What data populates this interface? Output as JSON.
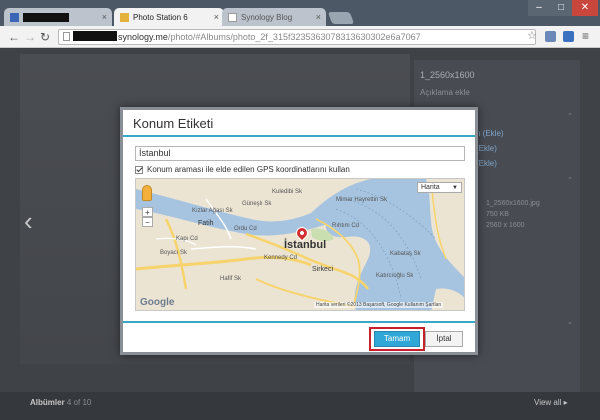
{
  "browser": {
    "tabs": [
      {
        "label": ""
      },
      {
        "label": "Photo Station 6"
      },
      {
        "label": "Synology Blog"
      }
    ],
    "url": {
      "host": "synology.me",
      "path": "/photo/#Albums/photo_2f_315f3235363078313630302e6a7067"
    },
    "window_buttons": {
      "minimize": "–",
      "maximize": "□",
      "close": "✕"
    }
  },
  "page": {
    "right_panel": {
      "title": "1_2560x1600",
      "subtitle": "Açıklama ekle",
      "links": [
        "n (Ekle)",
        "(Ekle)",
        "(Ekle)"
      ],
      "file_info": [
        "1_2560x1600.jpg",
        "750 KB",
        "2560 x 1600"
      ]
    },
    "footer": {
      "albums_label": "Albümler",
      "albums_count": "4 of 10",
      "view_all": "View all ▸"
    },
    "prev_arrow": "‹"
  },
  "dialog": {
    "title": "Konum Etiketi",
    "location_value": "İstanbul",
    "gps_checkbox_checked": true,
    "gps_checkbox_label": "Konum araması ile elde edilen GPS koordinatlarını kullan",
    "map": {
      "type_selector": "Harita",
      "zoom_in": "+",
      "zoom_out": "−",
      "google_label": "Google",
      "attribution": "Harita verileri ©2013 Başarsoft, Google   Kullanım Şartları",
      "labels": {
        "city": "İstanbul",
        "fatih": "Fatih",
        "ordu": "Ordu Cd",
        "sirkeci": "Sirkeci",
        "kennedy": "Kennedy Cd",
        "kapi": "Kapı Cd",
        "kizlar": "Kızlar Ağası Sk",
        "gunes": "Güneşlı Sk",
        "boyaci": "Boyacı Sk",
        "rihtim": "Rıhtım Cd",
        "hafif": "Hafif Sk",
        "kitaplar1": "Katırcıoğlu Sk",
        "kitaplar2": "Kabataş Sk",
        "mevlana": "Mimar Hayrettin Sk",
        "kuzeybati": "Kuledibi Sk"
      }
    },
    "ok_label": "Tamam",
    "cancel_label": "İptal"
  },
  "colors": {
    "accent": "#31a7d7",
    "highlight_frame": "#c8202a",
    "separator": "#37a7c8"
  }
}
